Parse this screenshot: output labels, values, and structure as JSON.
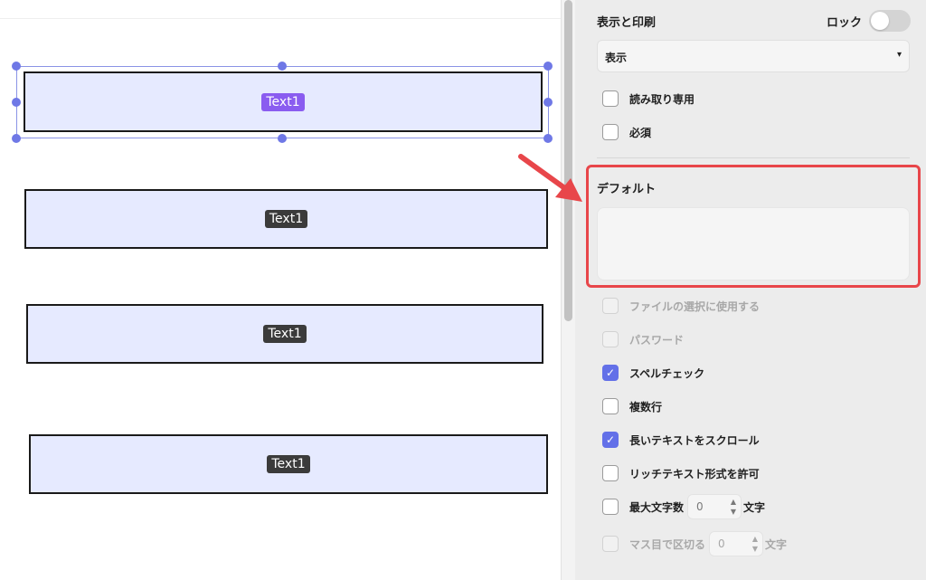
{
  "canvas": {
    "fields": [
      {
        "tag": "Text1",
        "selected": true
      },
      {
        "tag": "Text1",
        "selected": false
      },
      {
        "tag": "Text1",
        "selected": false
      },
      {
        "tag": "Text1",
        "selected": false
      }
    ]
  },
  "panel": {
    "section_title": "表示と印刷",
    "lock_label": "ロック",
    "lock_on": false,
    "visibility_select": {
      "value": "表示",
      "caret": "▾"
    },
    "options_top": [
      {
        "label": "読み取り専用",
        "checked": false,
        "disabled": false
      },
      {
        "label": "必須",
        "checked": false,
        "disabled": false
      }
    ],
    "default_label": "デフォルト",
    "default_value": "",
    "options_bottom": [
      {
        "label": "ファイルの選択に使用する",
        "checked": false,
        "disabled": true
      },
      {
        "label": "パスワード",
        "checked": false,
        "disabled": true
      },
      {
        "label": "スペルチェック",
        "checked": true,
        "disabled": false
      },
      {
        "label": "複数行",
        "checked": false,
        "disabled": false
      },
      {
        "label": "長いテキストをスクロール",
        "checked": true,
        "disabled": false
      },
      {
        "label": "リッチテキスト形式を許可",
        "checked": false,
        "disabled": false
      }
    ],
    "max_chars": {
      "label": "最大文字数",
      "value": "0",
      "suffix": "文字",
      "checked": false,
      "disabled": false
    },
    "comb": {
      "label": "マス目で区切る",
      "value": "0",
      "suffix": "文字",
      "checked": false,
      "disabled": true
    },
    "stepper_arrows": {
      "up": "▲",
      "down": "▼"
    },
    "check_glyph": "✓"
  },
  "colors": {
    "accent": "#6370e8",
    "highlight": "#e8464a",
    "field_fill": "#e6eaff",
    "selected_tag": "#8a5cf0"
  }
}
